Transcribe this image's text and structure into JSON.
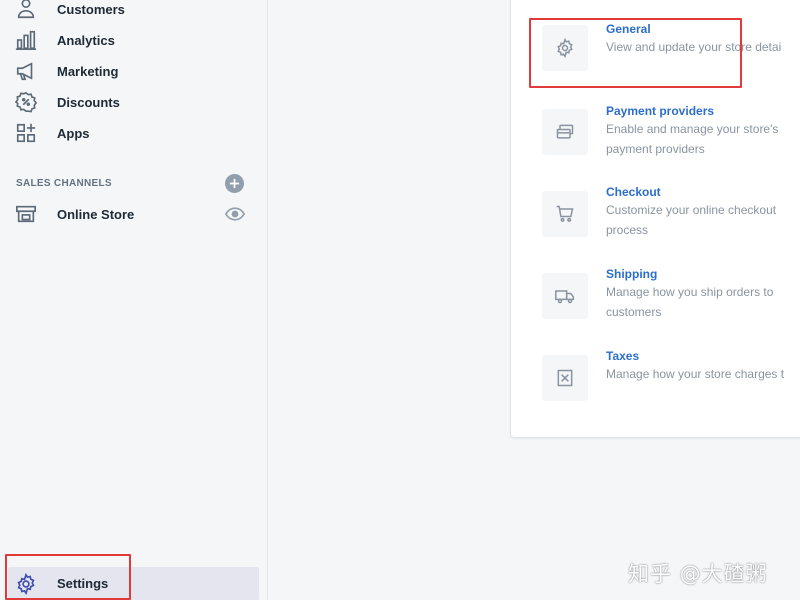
{
  "sidebar": {
    "items": [
      {
        "label": "Customers",
        "icon": "person-icon"
      },
      {
        "label": "Analytics",
        "icon": "bar-chart-icon"
      },
      {
        "label": "Marketing",
        "icon": "megaphone-icon"
      },
      {
        "label": "Discounts",
        "icon": "discount-icon"
      },
      {
        "label": "Apps",
        "icon": "apps-icon"
      }
    ],
    "sales_channels_title": "SALES CHANNELS",
    "channels": [
      {
        "label": "Online Store",
        "icon": "store-icon"
      }
    ],
    "settings_label": "Settings"
  },
  "settings_list": [
    {
      "title": "General",
      "description": "View and update your store detai",
      "icon": "gear-icon"
    },
    {
      "title": "Payment providers",
      "description": "Enable and manage your store's payment providers",
      "icon": "payment-icon"
    },
    {
      "title": "Checkout",
      "description": "Customize your online checkout process",
      "icon": "cart-icon"
    },
    {
      "title": "Shipping",
      "description": "Manage how you ship orders to customers",
      "icon": "truck-icon"
    },
    {
      "title": "Taxes",
      "description": "Manage how your store charges t",
      "icon": "taxes-icon"
    }
  ],
  "watermark": "知乎 @大碴粥",
  "colors": {
    "accent_link": "#2c6ecb",
    "highlight_box": "#e03a3a",
    "sidebar_active_bg": "#e4e5ef",
    "icon_gray": "#5c6a78"
  }
}
